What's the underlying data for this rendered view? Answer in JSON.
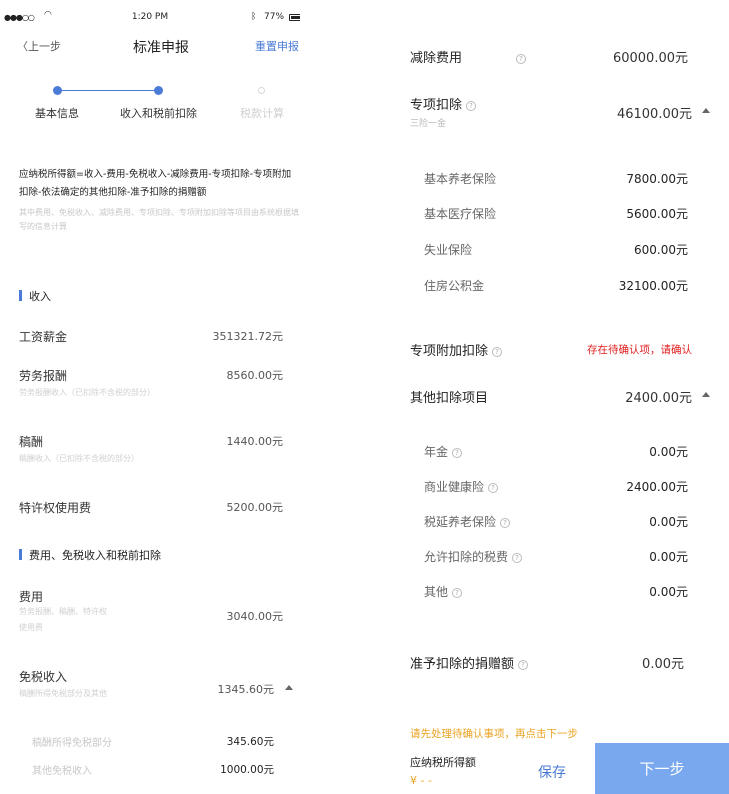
{
  "status_bar": {
    "signal": "●●●○○",
    "time": "1:20 PM",
    "battery": "77%"
  },
  "nav": {
    "back": "上一步",
    "title": "标准申报",
    "reset": "重置申报"
  },
  "steps": [
    {
      "label": "基本信息"
    },
    {
      "label": "收入和税前扣除"
    },
    {
      "label": "税款计算"
    }
  ],
  "formula": "应纳税所得额=收入-费用-免税收入-减除费用-专项扣除-专项附加扣除-依法确定的其他扣除-准予扣除的捐赠额",
  "formula_note": "其中费用、免税收入、减除费用、专项扣除、专项附加扣除等项目由系统根据填写的信息计算",
  "income": {
    "title": "收入",
    "rows": [
      {
        "label": "工资薪金",
        "value": "351321.72元",
        "note": ""
      },
      {
        "label": "劳务报酬",
        "value": "8560.00元",
        "note": "劳务报酬收入（已扣除不含税的部分）"
      },
      {
        "label": "稿酬",
        "value": "1440.00元",
        "note": "稿酬收入（已扣除不含税的部分）"
      },
      {
        "label": "特许权使用费",
        "value": "5200.00元",
        "note": ""
      }
    ]
  },
  "deductions": {
    "title": "费用、免税收入和税前扣除",
    "fee": {
      "label": "费用",
      "value": "3040.00元",
      "note1": "劳务报酬、稿酬、特许权",
      "note2": "使用费"
    },
    "exempt": {
      "label": "免税收入",
      "value": "1345.60元",
      "note": "稿酬所得免税部分及其他"
    },
    "exempt_items": [
      {
        "label": "稿酬所得免税部分",
        "value": "345.60元"
      },
      {
        "label": "其他免税收入",
        "value": "1000.00元"
      }
    ]
  },
  "right": {
    "deduct_fee": {
      "label": "减除费用",
      "value": "60000.00元"
    },
    "special": {
      "label": "专项扣除",
      "caption": "三险一金",
      "value": "46100.00元"
    },
    "special_items": [
      {
        "label": "基本养老保险",
        "value": "7800.00元"
      },
      {
        "label": "基本医疗保险",
        "value": "5600.00元"
      },
      {
        "label": "失业保险",
        "value": "600.00元"
      },
      {
        "label": "住房公积金",
        "value": "32100.00元"
      }
    ],
    "special_additional": {
      "label": "专项附加扣除",
      "pending": "存在待确认项，请确认"
    },
    "other": {
      "label": "其他扣除项目",
      "value": "2400.00元"
    },
    "other_items": [
      {
        "label": "年金",
        "value": "0.00元"
      },
      {
        "label": "商业健康险",
        "value": "2400.00元"
      },
      {
        "label": "税延养老保险",
        "value": "0.00元"
      },
      {
        "label": "允许扣除的税费",
        "value": "0.00元"
      },
      {
        "label": "其他",
        "value": "0.00元"
      }
    ],
    "donation": {
      "label": "准予扣除的捐赠额",
      "value": "0.00元"
    },
    "warning": "请先处理待确认事项，再点击下一步",
    "taxable_label": "应纳税所得额",
    "taxable_value": "¥ - -",
    "save": "保存",
    "next": "下一步"
  },
  "colors": {
    "accent": "#4a7bd6",
    "warning": "#e8a322",
    "alert": "#e02020",
    "button": "#7aa8ee"
  }
}
